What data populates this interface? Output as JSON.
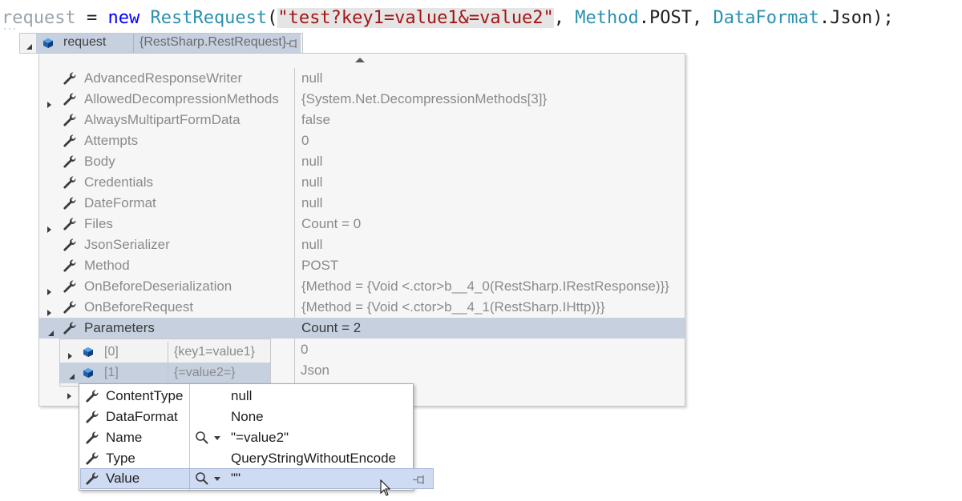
{
  "code": {
    "ident": "request",
    "op": " = ",
    "kw_new": "new",
    "space": " ",
    "type_name": "RestRequest",
    "paren_open": "(",
    "string_literal": "\"test?key1=value1&=value2\"",
    "comma1": ", ",
    "method_type": "Method",
    "method_member": ".POST",
    "comma2": ", ",
    "format_type": "DataFormat",
    "format_member": ".Json",
    "end": ");"
  },
  "root_tip": {
    "name": "request",
    "value": "{RestSharp.RestRequest}"
  },
  "properties": [
    {
      "name": "AdvancedResponseWriter",
      "value": "null",
      "expandable": false
    },
    {
      "name": "AllowedDecompressionMethods",
      "value": "{System.Net.DecompressionMethods[3]}",
      "expandable": true
    },
    {
      "name": "AlwaysMultipartFormData",
      "value": "false",
      "expandable": false
    },
    {
      "name": "Attempts",
      "value": "0",
      "expandable": false
    },
    {
      "name": "Body",
      "value": "null",
      "expandable": false
    },
    {
      "name": "Credentials",
      "value": "null",
      "expandable": false
    },
    {
      "name": "DateFormat",
      "value": "null",
      "expandable": false
    },
    {
      "name": "Files",
      "value": "Count = 0",
      "expandable": true
    },
    {
      "name": "JsonSerializer",
      "value": "null",
      "expandable": false
    },
    {
      "name": "Method",
      "value": "POST",
      "expandable": false
    },
    {
      "name": "OnBeforeDeserialization",
      "value": "{Method = {Void <.ctor>b__4_0(RestSharp.IRestResponse)}}",
      "expandable": true
    },
    {
      "name": "OnBeforeRequest",
      "value": "{Method = {Void <.ctor>b__4_1(RestSharp.IHttp)}}",
      "expandable": true
    },
    {
      "name": "Parameters",
      "value": "Count = 2",
      "expandable": true
    }
  ],
  "partial_values": [
    "0",
    "Json"
  ],
  "parameters": [
    {
      "name": "[0]",
      "value": "{key1=value1}"
    },
    {
      "name": "[1]",
      "value": "{=value2=}"
    }
  ],
  "param1_fields": [
    {
      "name": "ContentType",
      "value": "null"
    },
    {
      "name": "DataFormat",
      "value": "None"
    },
    {
      "name": "Name",
      "value": "\"=value2\""
    },
    {
      "name": "Type",
      "value": "QueryStringWithoutEncode"
    }
  ],
  "value_row": {
    "name": "Value",
    "value": "\"\""
  },
  "icons": {
    "property": "wrench-icon",
    "object": "cube-icon",
    "pin": "pin-icon",
    "visualizer": "magnifier-icon"
  },
  "colors": {
    "selection": "#c6d0df",
    "value_row_highlight": "#cfdbf3",
    "string": "#a31515",
    "keyword": "#0000ff",
    "type": "#2b91af"
  }
}
